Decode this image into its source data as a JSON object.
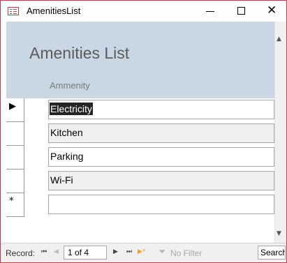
{
  "window": {
    "title": "AmenitiesList",
    "controls": {
      "minimize": "—",
      "maximize": "□",
      "close": "✕"
    }
  },
  "form": {
    "title": "Amenities List",
    "column_header": "Ammenity"
  },
  "rows": [
    {
      "value": "Electricity",
      "selector": "▶",
      "selected": true
    },
    {
      "value": "Kitchen",
      "selector": ""
    },
    {
      "value": "Parking",
      "selector": ""
    },
    {
      "value": "Wi-Fi",
      "selector": ""
    },
    {
      "value": "",
      "selector": "*"
    }
  ],
  "navigation": {
    "label": "Record:",
    "position": "1 of 4",
    "first_icon": "⏮",
    "prev_icon": "◀",
    "next_icon": "▶",
    "last_icon": "⏭",
    "new_icon": "▶*",
    "filter_label": "No Filter",
    "search_placeholder": "Search"
  },
  "icons": {
    "app": "form-icon",
    "filter": "funnel-icon",
    "scroll_up": "▲",
    "scroll_down": "▼"
  }
}
